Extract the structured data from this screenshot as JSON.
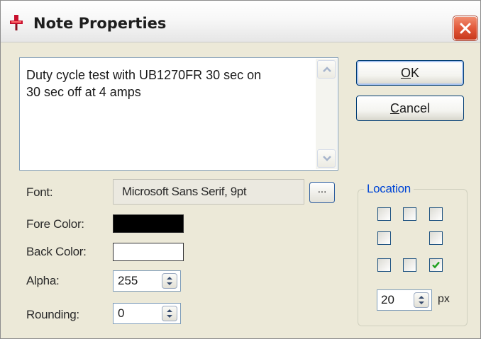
{
  "window": {
    "title": "Note Properties",
    "icon": "pushpin-icon",
    "close_icon": "close-icon"
  },
  "note": {
    "text": "Duty cycle test with UB1270FR 30 sec on\n30 sec off at 4 amps"
  },
  "buttons": {
    "ok_accel": "O",
    "ok_rest": "K",
    "cancel_accel": "C",
    "cancel_rest": "ancel",
    "browse": "..."
  },
  "labels": {
    "font": "Font:",
    "fore_color": "Fore Color:",
    "back_color": "Back Color:",
    "alpha": "Alpha:",
    "rounding": "Rounding:"
  },
  "font": {
    "value": "Microsoft Sans Serif, 9pt"
  },
  "colors": {
    "fore": "#000000",
    "back": "#ffffff",
    "accent": "#0046d5"
  },
  "alpha": {
    "value": "255"
  },
  "rounding": {
    "value": "0"
  },
  "location": {
    "legend": "Location",
    "checks": [
      false,
      false,
      false,
      false,
      false,
      false,
      false,
      true
    ],
    "selected": "bottom-right",
    "offset_value": "20",
    "offset_unit": "px"
  }
}
